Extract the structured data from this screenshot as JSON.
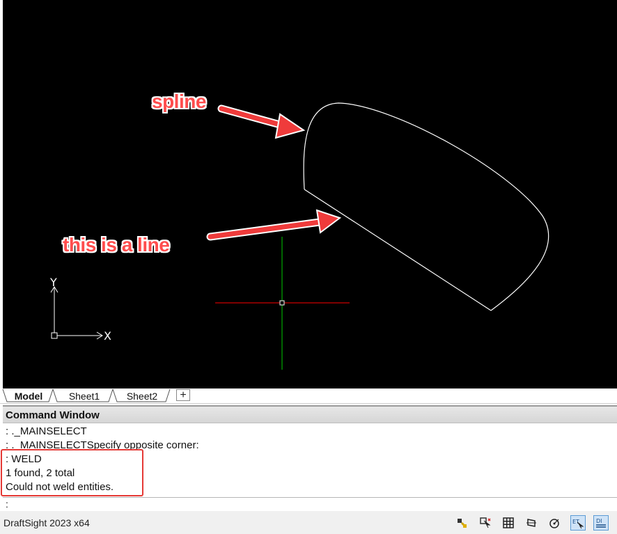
{
  "annotations": {
    "spline_label": "spline",
    "line_label": "this is a line"
  },
  "axes": {
    "x_label": "X",
    "y_label": "Y"
  },
  "tabs": [
    {
      "label": "Model",
      "active": true
    },
    {
      "label": "Sheet1",
      "active": false
    },
    {
      "label": "Sheet2",
      "active": false
    }
  ],
  "add_tab_label": "+",
  "command_window": {
    "title": "Command Window",
    "log": [
      ": ._MAINSELECT",
      ": ._MAINSELECTSpecify opposite corner:",
      ": WELD",
      "1 found, 2 total",
      "Could not weld entities."
    ],
    "prompt": ":"
  },
  "status_bar": {
    "app_version": "DraftSight 2023 x64",
    "buttons": [
      {
        "name": "snap-icon",
        "active": false
      },
      {
        "name": "entity-snap-icon",
        "active": false
      },
      {
        "name": "grid-icon",
        "active": false
      },
      {
        "name": "ortho-icon",
        "active": false
      },
      {
        "name": "polar-icon",
        "active": false
      },
      {
        "name": "entity-tracking-icon",
        "active": true
      },
      {
        "name": "dynamic-input-icon",
        "active": true
      }
    ]
  },
  "colors": {
    "canvas_bg": "#000000",
    "annotation_red": "#ff4d4d",
    "crosshair_x": "#ff0000",
    "crosshair_y": "#00cc00",
    "highlight_box": "#e53935"
  }
}
